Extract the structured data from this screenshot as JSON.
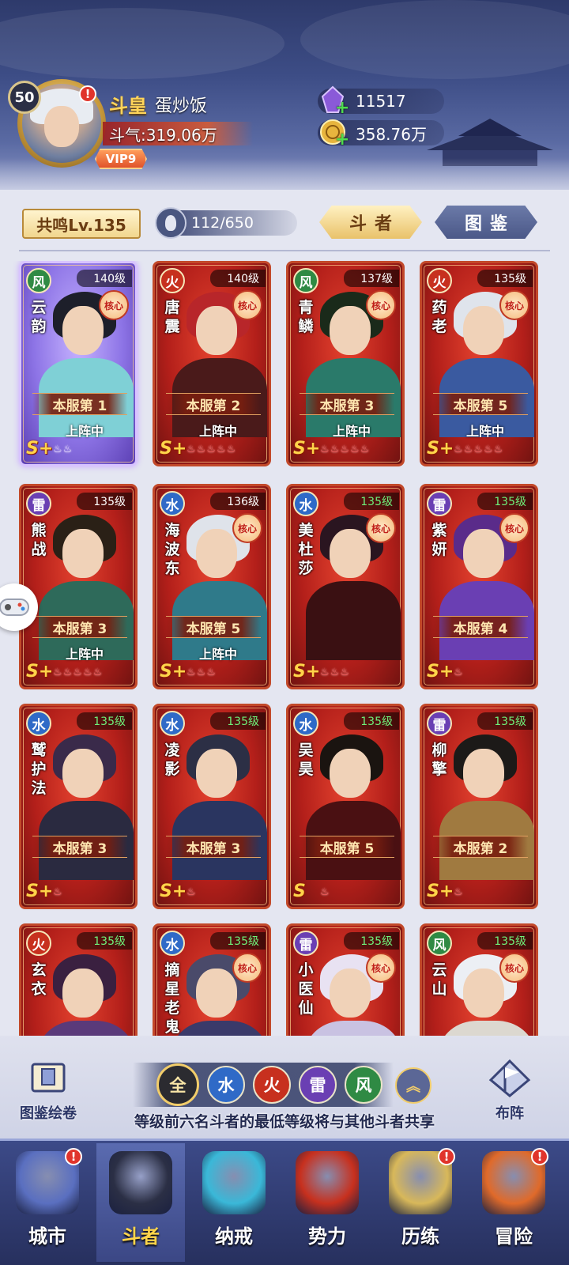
{
  "player": {
    "level": "50",
    "rank_title": "斗皇",
    "name": "蛋炒饭",
    "power": "斗气:319.06万",
    "vip": "VIP9",
    "alert": "!"
  },
  "currency": {
    "crystal": "11517",
    "gold": "358.76万"
  },
  "toolbar": {
    "resonance": "共鸣Lv.135",
    "fighter_count": "112/650",
    "tab_fighters": "斗者",
    "tab_gallery": "图鉴"
  },
  "cards": [
    {
      "element": "风",
      "level": "140级",
      "name": "云韵",
      "core": "核心",
      "rank": "本服第 1",
      "status": "上阵中",
      "grade": "S+",
      "stars": "♨♨"
    },
    {
      "element": "火",
      "level": "140级",
      "name": "唐震",
      "core": "核心",
      "rank": "本服第 2",
      "status": "上阵中",
      "grade": "S+",
      "stars": "♨♨♨♨♨"
    },
    {
      "element": "风",
      "level": "137级",
      "name": "青鳞",
      "core": "核心",
      "rank": "本服第 3",
      "status": "上阵中",
      "grade": "S+",
      "stars": "♨♨♨♨♨"
    },
    {
      "element": "火",
      "level": "135级",
      "name": "药老",
      "core": "核心",
      "rank": "本服第 5",
      "status": "上阵中",
      "grade": "S+",
      "stars": "♨♨♨♨♨"
    },
    {
      "element": "雷",
      "level": "135级",
      "name": "熊战",
      "core": "",
      "rank": "本服第 3",
      "status": "上阵中",
      "grade": "S+",
      "stars": "♨♨♨♨♨"
    },
    {
      "element": "水",
      "level": "136级",
      "name": "海波东",
      "core": "核心",
      "rank": "本服第 5",
      "status": "上阵中",
      "grade": "S+",
      "stars": "♨♨♨"
    },
    {
      "element": "水",
      "level": "135级",
      "name": "美杜莎",
      "core": "核心",
      "rank": "",
      "status": "",
      "grade": "S+",
      "stars": "♨♨♨"
    },
    {
      "element": "雷",
      "level": "135级",
      "name": "紫妍",
      "core": "核心",
      "rank": "本服第 4",
      "status": "",
      "grade": "S+",
      "stars": "♨"
    },
    {
      "element": "水",
      "level": "135级",
      "name": "鹫护法",
      "core": "",
      "rank": "本服第 3",
      "status": "",
      "grade": "S+",
      "stars": "♨"
    },
    {
      "element": "水",
      "level": "135级",
      "name": "凌影",
      "core": "",
      "rank": "本服第 3",
      "status": "",
      "grade": "S+",
      "stars": "♨"
    },
    {
      "element": "水",
      "level": "135级",
      "name": "吴昊",
      "core": "",
      "rank": "本服第 5",
      "status": "",
      "grade": "S",
      "stars": "♨"
    },
    {
      "element": "雷",
      "level": "135级",
      "name": "柳擎",
      "core": "",
      "rank": "本服第 2",
      "status": "",
      "grade": "S+",
      "stars": "♨"
    },
    {
      "element": "火",
      "level": "135级",
      "name": "玄衣",
      "core": "",
      "rank": "",
      "status": "",
      "grade": "",
      "stars": ""
    },
    {
      "element": "水",
      "level": "135级",
      "name": "摘星老鬼",
      "core": "核心",
      "rank": "",
      "status": "",
      "grade": "",
      "stars": ""
    },
    {
      "element": "雷",
      "level": "135级",
      "name": "小医仙",
      "core": "核心",
      "rank": "",
      "status": "",
      "grade": "",
      "stars": ""
    },
    {
      "element": "风",
      "level": "135级",
      "name": "云山",
      "core": "核心",
      "rank": "",
      "status": "",
      "grade": "",
      "stars": ""
    }
  ],
  "filters": {
    "all": "全",
    "water": "水",
    "fire": "火",
    "thunder": "雷",
    "wind": "风",
    "collapse": "︽",
    "left_label": "图鉴绘卷",
    "right_label": "布阵"
  },
  "tip": "等级前六名斗者的最低等级将与其他斗者共享",
  "nav": [
    {
      "label": "城市",
      "alert": "!"
    },
    {
      "label": "斗者",
      "alert": ""
    },
    {
      "label": "纳戒",
      "alert": ""
    },
    {
      "label": "势力",
      "alert": ""
    },
    {
      "label": "历练",
      "alert": "!"
    },
    {
      "label": "冒险",
      "alert": "!"
    }
  ]
}
